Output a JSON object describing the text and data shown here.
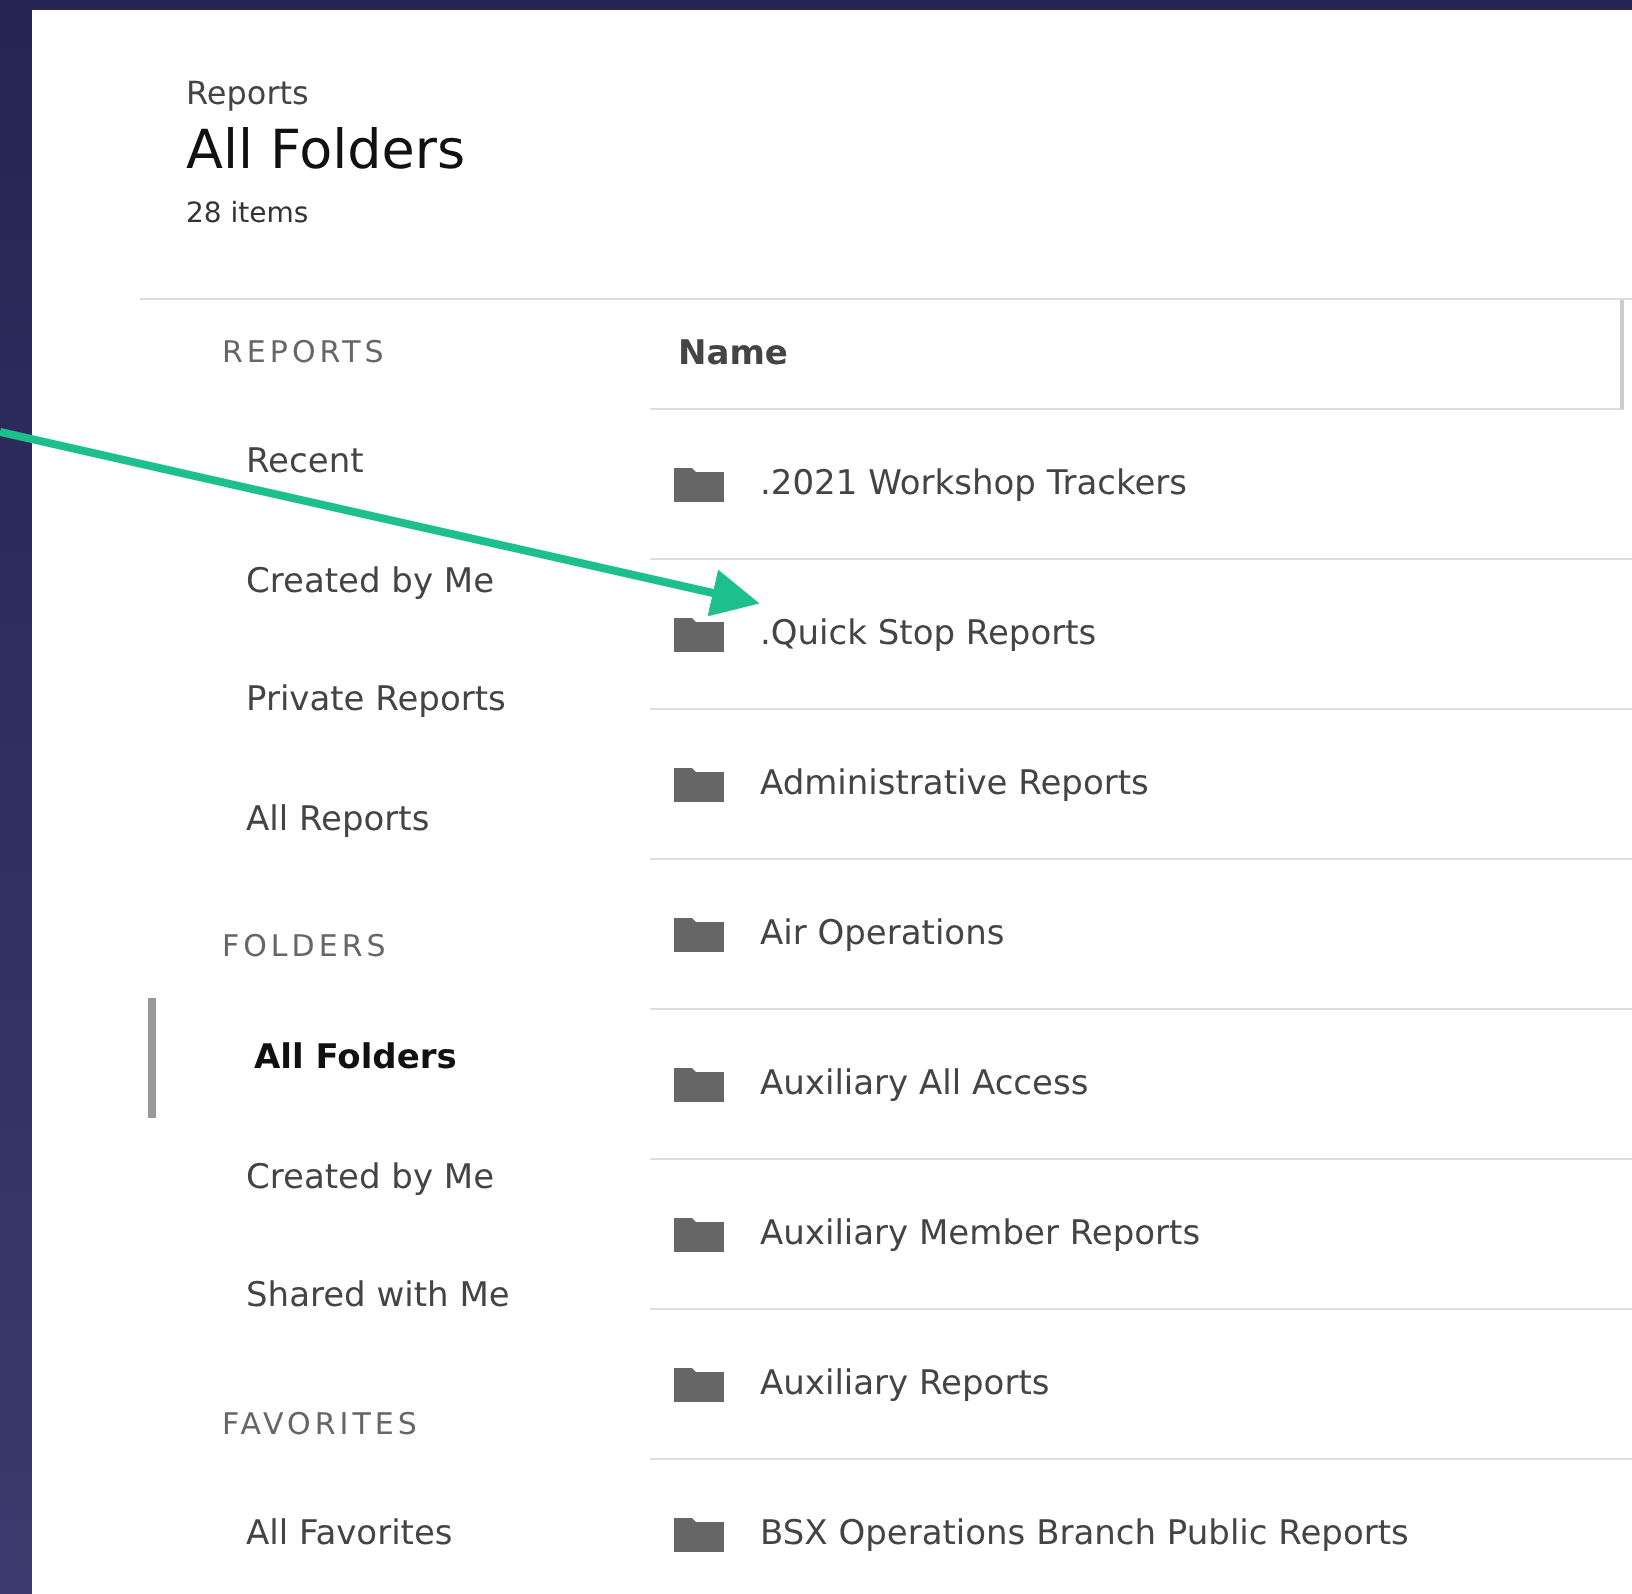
{
  "header": {
    "breadcrumb": "Reports",
    "title": "All Folders",
    "count": "28 items"
  },
  "sidebar": {
    "sections": [
      {
        "label": "REPORTS",
        "items": [
          {
            "label": "Recent",
            "selected": false
          },
          {
            "label": "Created by Me",
            "selected": false
          },
          {
            "label": "Private Reports",
            "selected": false
          },
          {
            "label": "All Reports",
            "selected": false
          }
        ]
      },
      {
        "label": "FOLDERS",
        "items": [
          {
            "label": "All Folders",
            "selected": true
          },
          {
            "label": "Created by Me",
            "selected": false
          },
          {
            "label": "Shared with Me",
            "selected": false
          }
        ]
      },
      {
        "label": "FAVORITES",
        "items": [
          {
            "label": "All Favorites",
            "selected": false
          }
        ]
      }
    ]
  },
  "table": {
    "columns": [
      "Name"
    ],
    "rows": [
      {
        "name": ".2021 Workshop Trackers"
      },
      {
        "name": ".Quick Stop Reports"
      },
      {
        "name": "Administrative Reports"
      },
      {
        "name": "Air Operations"
      },
      {
        "name": "Auxiliary All Access"
      },
      {
        "name": "Auxiliary Member Reports"
      },
      {
        "name": "Auxiliary Reports"
      },
      {
        "name": "BSX Operations Branch Public Reports"
      }
    ]
  }
}
